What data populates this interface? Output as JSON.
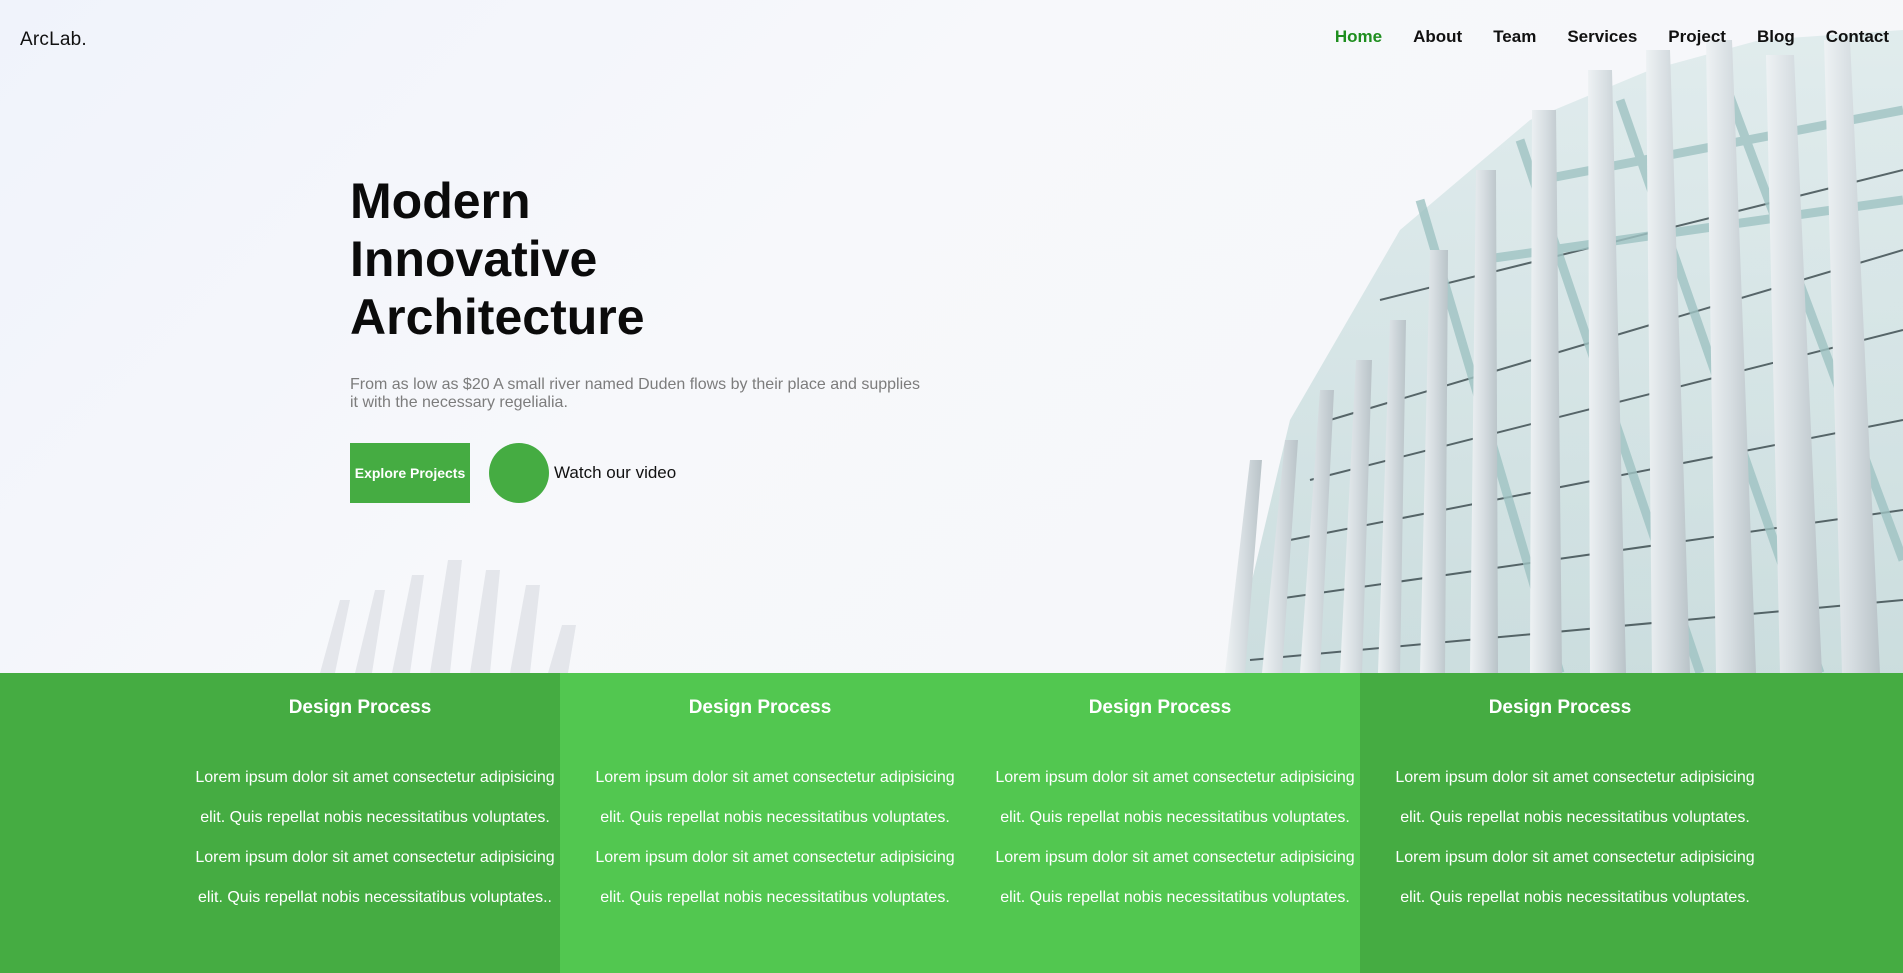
{
  "brand": {
    "logo": "ArcLab."
  },
  "nav": {
    "items": [
      {
        "label": "Home",
        "active": true
      },
      {
        "label": "About",
        "active": false
      },
      {
        "label": "Team",
        "active": false
      },
      {
        "label": "Services",
        "active": false
      },
      {
        "label": "Project",
        "active": false
      },
      {
        "label": "Blog",
        "active": false
      },
      {
        "label": "Contact",
        "active": false
      }
    ]
  },
  "hero": {
    "title_line1": "Modern",
    "title_line2": "Innovative",
    "title_line3": "Architecture",
    "subtitle": "From as low as $20 A small river named Duden flows by their place and supplies it with the necessary regelialia.",
    "primary_button": "Explore Projects",
    "video_label": "Watch our video",
    "play_icon": "play-icon"
  },
  "features": [
    {
      "title": "Design Process",
      "text": "Lorem ipsum dolor sit amet consectetur adipisicing elit. Quis repellat nobis necessitatibus voluptates. Lorem ipsum dolor sit amet consectetur adipisicing elit. Quis repellat nobis necessitatibus voluptates.."
    },
    {
      "title": "Design Process",
      "text": "Lorem ipsum dolor sit amet consectetur adipisicing elit. Quis repellat nobis necessitatibus voluptates. Lorem ipsum dolor sit amet consectetur adipisicing elit. Quis repellat nobis necessitatibus voluptates."
    },
    {
      "title": "Design Process",
      "text": "Lorem ipsum dolor sit amet consectetur adipisicing elit. Quis repellat nobis necessitatibus voluptates. Lorem ipsum dolor sit amet consectetur adipisicing elit. Quis repellat nobis necessitatibus voluptates."
    },
    {
      "title": "Design Process",
      "text": "Lorem ipsum dolor sit amet consectetur adipisicing elit. Quis repellat nobis necessitatibus voluptates. Lorem ipsum dolor sit amet consectetur adipisicing elit. Quis repellat nobis necessitatibus voluptates."
    }
  ],
  "colors": {
    "accent": "#45ac42",
    "accent_light": "#52c750",
    "nav_active": "#1e8e1e"
  }
}
